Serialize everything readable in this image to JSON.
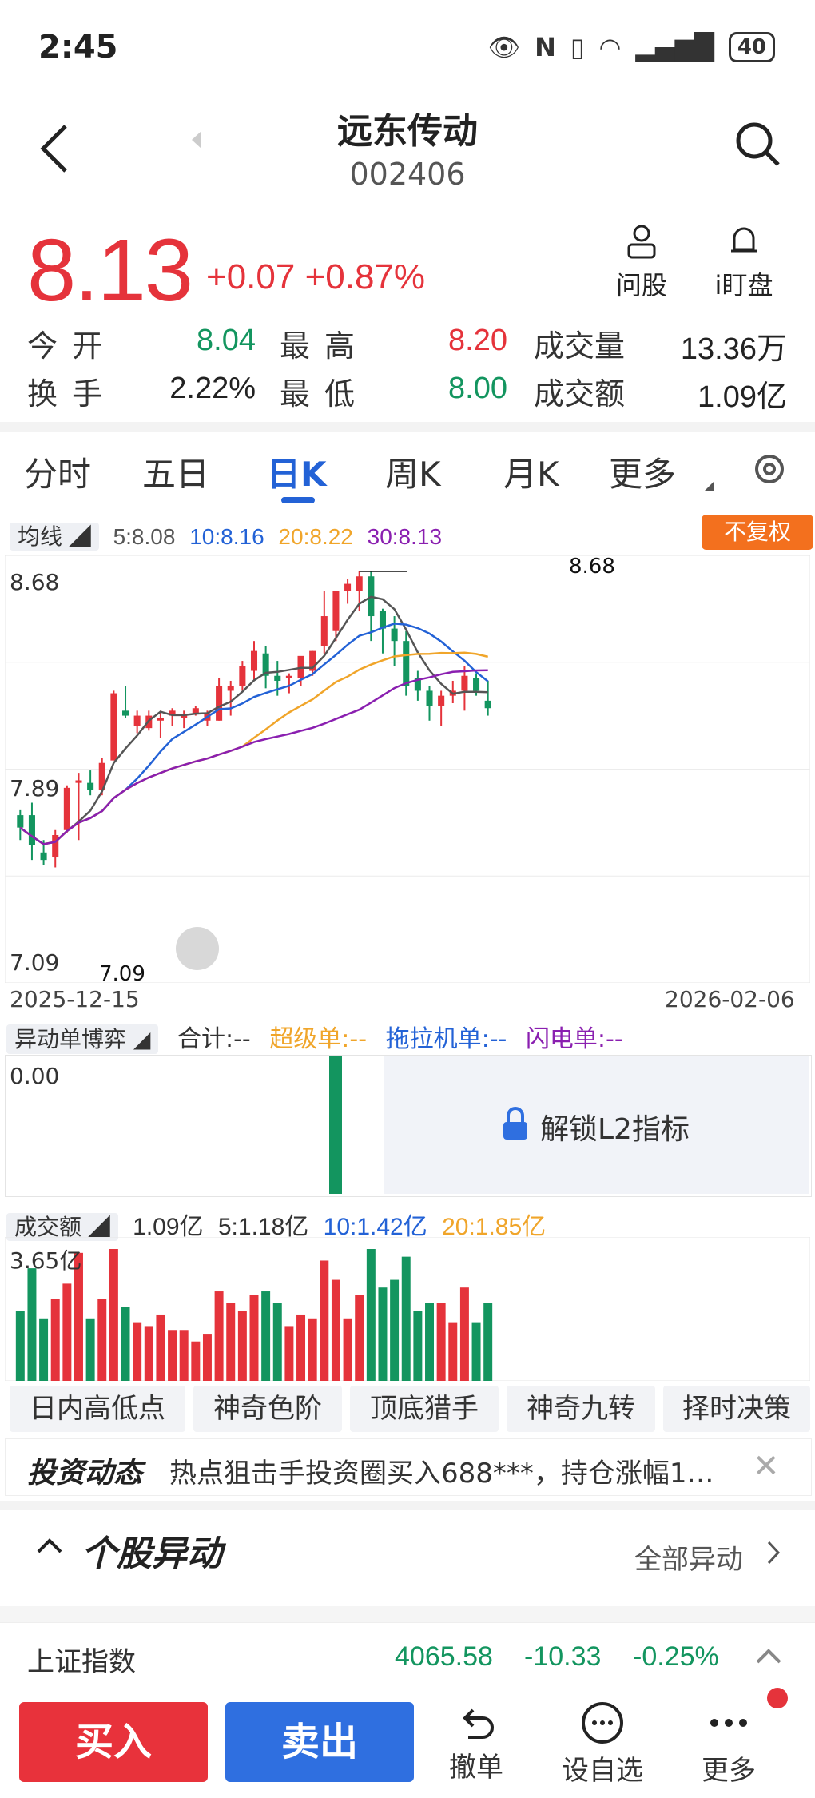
{
  "status": {
    "time": "2:45",
    "battery": "40"
  },
  "header": {
    "title": "远东传动",
    "code": "002406"
  },
  "quote": {
    "price": "8.13",
    "change": "+0.07",
    "change_pct": "+0.87%"
  },
  "quick_actions": [
    {
      "label": "问股",
      "icon": "person-icon"
    },
    {
      "label": "i盯盘",
      "icon": "bell-icon"
    }
  ],
  "stats": [
    {
      "label": "今开",
      "value": "8.04",
      "color": "green"
    },
    {
      "label": "最高",
      "value": "8.20",
      "color": "red"
    },
    {
      "label": "成交量",
      "value": "13.36万",
      "color": "dark"
    },
    {
      "label": "换手",
      "value": "2.22%",
      "color": "dark"
    },
    {
      "label": "最低",
      "value": "8.00",
      "color": "green"
    },
    {
      "label": "成交额",
      "value": "1.09亿",
      "color": "dark"
    }
  ],
  "tabs": [
    "分时",
    "五日",
    "日K",
    "周K",
    "月K",
    "更多"
  ],
  "active_tab": "日K",
  "ma": {
    "chip": "均线",
    "ma5": "5:8.08",
    "ma10": "10:8.16",
    "ma20": "20:8.22",
    "ma30": "30:8.13",
    "badge": "不复权"
  },
  "chart_labels": {
    "top": "8.68",
    "mid": "7.89",
    "bottom": "7.09",
    "high_mark": "8.68",
    "low_mark": "7.09",
    "start_date": "2025-12-15",
    "end_date": "2026-02-06"
  },
  "l2": {
    "chip": "异动单博弈",
    "total": "合计:--",
    "super": "超级单:--",
    "tractor": "拖拉机单:--",
    "flash": "闪电单:--",
    "value": "0.00",
    "unlock": "解锁L2指标"
  },
  "volume": {
    "chip": "成交额",
    "today": "1.09亿",
    "ma5": "5:1.18亿",
    "ma10": "10:1.42亿",
    "ma20": "20:1.85亿",
    "max": "3.65亿"
  },
  "tools": [
    "日内高低点",
    "神奇色阶",
    "顶底猎手",
    "神奇九转",
    "择时决策"
  ],
  "news": {
    "title": "投资动态",
    "text": "热点狙击手投资圈买入688***，持仓涨幅1…"
  },
  "section": {
    "title": "个股异动",
    "link": "全部异动"
  },
  "index": {
    "name": "上证指数",
    "value": "4065.58",
    "change": "-10.33",
    "pct": "-0.25%"
  },
  "bottom_nav": {
    "buy": "买入",
    "sell": "卖出",
    "items": [
      {
        "label": "撤单",
        "icon": "undo-icon"
      },
      {
        "label": "设自选",
        "icon": "chat-icon"
      },
      {
        "label": "更多",
        "icon": "more-icon"
      }
    ]
  },
  "colors": {
    "up": "#e5333b",
    "down": "#13955f",
    "ma5": "#555555",
    "ma10": "#2362d6",
    "ma20": "#f0a52a",
    "ma30": "#8a1fb0",
    "accent": "#2362d6"
  },
  "chart_data": {
    "type": "candlestick",
    "x_start": "2025-12-15",
    "x_end": "2026-02-06",
    "ylim": [
      7.09,
      8.68
    ],
    "candles": [
      [
        7.7,
        7.72,
        7.6,
        7.65
      ],
      [
        7.7,
        7.75,
        7.52,
        7.58
      ],
      [
        7.55,
        7.6,
        7.5,
        7.52
      ],
      [
        7.53,
        7.64,
        7.49,
        7.62
      ],
      [
        7.64,
        7.82,
        7.63,
        7.81
      ],
      [
        7.83,
        7.87,
        7.6,
        7.84
      ],
      [
        7.83,
        7.88,
        7.78,
        7.8
      ],
      [
        7.8,
        7.93,
        7.78,
        7.91
      ],
      [
        7.92,
        8.2,
        7.92,
        8.19
      ],
      [
        8.12,
        8.22,
        8.09,
        8.1
      ],
      [
        8.06,
        8.12,
        8.03,
        8.1
      ],
      [
        8.05,
        8.12,
        8.04,
        8.1
      ],
      [
        8.08,
        8.12,
        8.01,
        8.09
      ],
      [
        8.1,
        8.13,
        8.06,
        8.12
      ],
      [
        8.09,
        8.12,
        8.05,
        8.1
      ],
      [
        8.11,
        8.14,
        8.1,
        8.13
      ],
      [
        8.08,
        8.12,
        8.06,
        8.11
      ],
      [
        8.08,
        8.25,
        8.08,
        8.22
      ],
      [
        8.2,
        8.24,
        8.1,
        8.22
      ],
      [
        8.22,
        8.32,
        8.2,
        8.3
      ],
      [
        8.28,
        8.4,
        8.24,
        8.36
      ],
      [
        8.35,
        8.38,
        8.21,
        8.26
      ],
      [
        8.26,
        8.32,
        8.18,
        8.24
      ],
      [
        8.25,
        8.27,
        8.19,
        8.26
      ],
      [
        8.25,
        8.33,
        8.22,
        8.34
      ],
      [
        8.28,
        8.36,
        8.26,
        8.36
      ],
      [
        8.38,
        8.6,
        8.35,
        8.5
      ],
      [
        8.44,
        8.6,
        8.4,
        8.6
      ],
      [
        8.6,
        8.65,
        8.55,
        8.63
      ],
      [
        8.6,
        8.68,
        8.52,
        8.66
      ],
      [
        8.66,
        8.68,
        8.4,
        8.5
      ],
      [
        8.52,
        8.53,
        8.35,
        8.45
      ],
      [
        8.45,
        8.5,
        8.3,
        8.4
      ],
      [
        8.4,
        8.44,
        8.18,
        8.22
      ],
      [
        8.25,
        8.28,
        8.16,
        8.2
      ],
      [
        8.2,
        8.22,
        8.08,
        8.14
      ],
      [
        8.14,
        8.2,
        8.06,
        8.18
      ],
      [
        8.18,
        8.24,
        8.15,
        8.2
      ],
      [
        8.2,
        8.3,
        8.12,
        8.26
      ],
      [
        8.25,
        8.27,
        8.18,
        8.2
      ],
      [
        8.16,
        8.24,
        8.1,
        8.13
      ]
    ]
  }
}
